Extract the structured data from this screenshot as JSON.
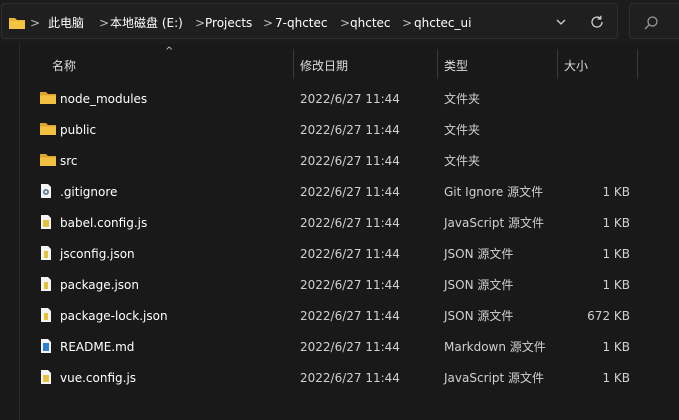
{
  "breadcrumb": [
    "此电脑",
    "本地磁盘 (E:)",
    "Projects",
    "7-qhctec",
    "qhctec",
    "qhctec_ui"
  ],
  "breadcrumb_separator": ">",
  "columns": {
    "name": "名称",
    "date": "修改日期",
    "type": "类型",
    "size": "大小"
  },
  "files": [
    {
      "name": "node_modules",
      "date": "2022/6/27 11:44",
      "type": "文件夹",
      "size": "",
      "icon": "folder-icon"
    },
    {
      "name": "public",
      "date": "2022/6/27 11:44",
      "type": "文件夹",
      "size": "",
      "icon": "folder-icon"
    },
    {
      "name": "src",
      "date": "2022/6/27 11:44",
      "type": "文件夹",
      "size": "",
      "icon": "folder-icon"
    },
    {
      "name": ".gitignore",
      "date": "2022/6/27 11:44",
      "type": "Git Ignore 源文件",
      "size": "1 KB",
      "icon": "gear-file-icon"
    },
    {
      "name": "babel.config.js",
      "date": "2022/6/27 11:44",
      "type": "JavaScript 源文件",
      "size": "1 KB",
      "icon": "js-file-icon"
    },
    {
      "name": "jsconfig.json",
      "date": "2022/6/27 11:44",
      "type": "JSON 源文件",
      "size": "1 KB",
      "icon": "json-file-icon"
    },
    {
      "name": "package.json",
      "date": "2022/6/27 11:44",
      "type": "JSON 源文件",
      "size": "1 KB",
      "icon": "json-file-icon"
    },
    {
      "name": "package-lock.json",
      "date": "2022/6/27 11:44",
      "type": "JSON 源文件",
      "size": "672 KB",
      "icon": "json-file-icon"
    },
    {
      "name": "README.md",
      "date": "2022/6/27 11:44",
      "type": "Markdown 源文件",
      "size": "1 KB",
      "icon": "md-file-icon"
    },
    {
      "name": "vue.config.js",
      "date": "2022/6/27 11:44",
      "type": "JavaScript 源文件",
      "size": "1 KB",
      "icon": "js-file-icon"
    }
  ],
  "colors": {
    "background": "#191919",
    "folder": "#E8B634",
    "text": "#ffffff",
    "muted_text": "#d0d0d0"
  }
}
